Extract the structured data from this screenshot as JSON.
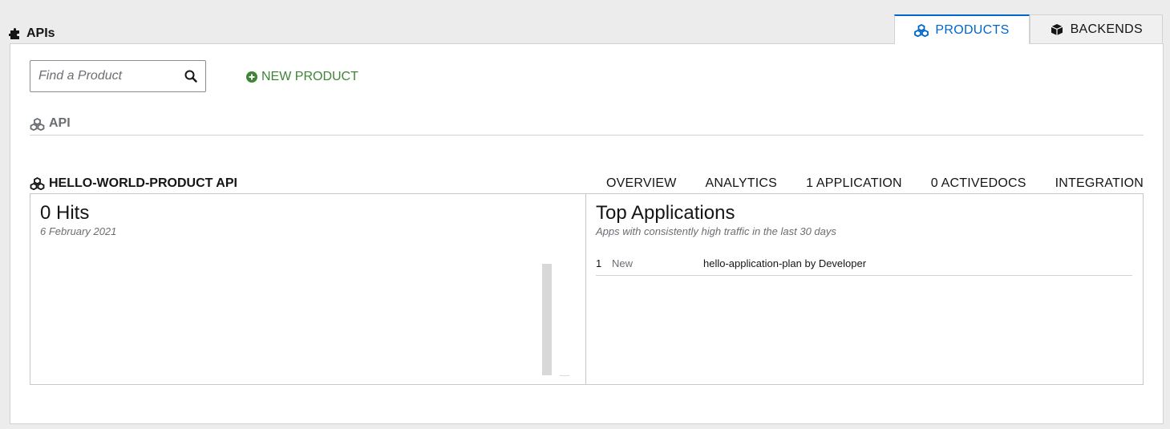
{
  "header": {
    "title": "APIs"
  },
  "tabs": [
    {
      "label": "PRODUCTS",
      "icon": "cubes-icon",
      "active": true
    },
    {
      "label": "BACKENDS",
      "icon": "cube-icon",
      "active": false
    }
  ],
  "toolbar": {
    "search_placeholder": "Find a Product",
    "search_value": "",
    "new_product_label": "NEW PRODUCT"
  },
  "section": {
    "title": "API"
  },
  "product": {
    "name": "HELLO-WORLD-PRODUCT API",
    "nav": [
      "OVERVIEW",
      "ANALYTICS",
      "1 APPLICATION",
      "0 ACTIVEDOCS",
      "INTEGRATION"
    ]
  },
  "hits_card": {
    "title": "0 Hits",
    "subtitle": "6 February 2021"
  },
  "top_apps_card": {
    "title": "Top Applications",
    "subtitle": "Apps with consistently high traffic in the last 30 days",
    "rows": [
      {
        "rank": "1",
        "state": "New",
        "name": "hello-application-plan by Developer"
      }
    ]
  },
  "colors": {
    "accent": "#0066cc",
    "success": "#3e8635",
    "muted": "#6a6e73"
  }
}
